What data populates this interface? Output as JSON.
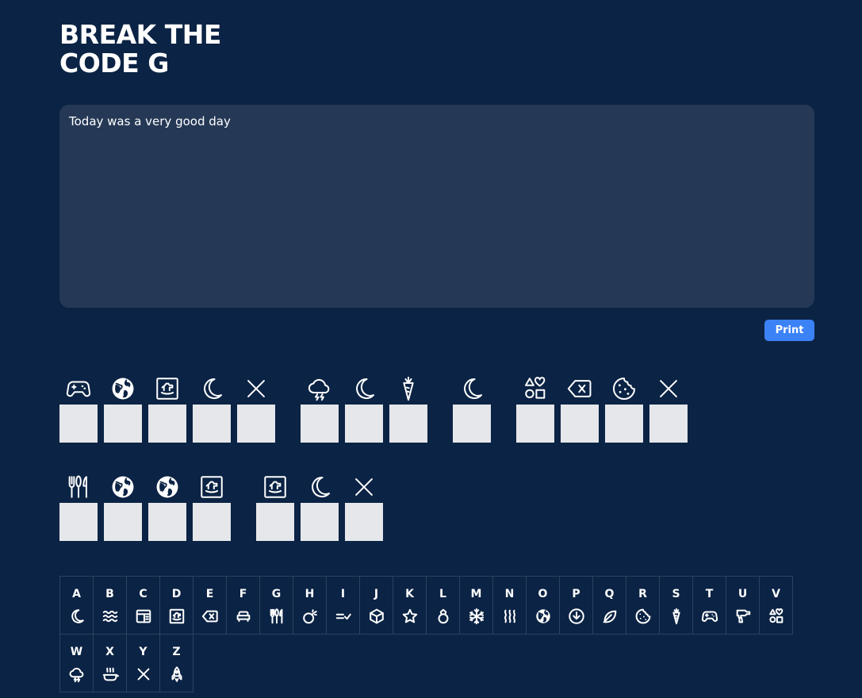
{
  "title": "BREAK THE CODE G",
  "title_lines": [
    "BREAK THE",
    "CODE G"
  ],
  "message": "Today was a very good day",
  "print_label": "Print",
  "colors": {
    "background": "#0b2344",
    "textarea": "#253956",
    "accent": "#3b82f6",
    "box": "#e5e7eb"
  },
  "puzzle": [
    [
      [
        "gamepad-icon",
        "globe-icon",
        "rocking-horse-icon",
        "moon-icon",
        "x-icon"
      ],
      [
        "storm-cloud-icon",
        "moon-icon",
        "carrot-icon"
      ],
      [
        "moon-icon"
      ],
      [
        "shapes-icon",
        "backspace-icon",
        "cookie-icon",
        "x-icon"
      ]
    ],
    [
      [
        "cutlery-icon",
        "globe-icon",
        "globe-icon",
        "rocking-horse-icon"
      ],
      [
        "rocking-horse-icon",
        "moon-icon",
        "x-icon"
      ]
    ]
  ],
  "key": [
    {
      "letter": "A",
      "icon": "moon-icon"
    },
    {
      "letter": "B",
      "icon": "waves-icon"
    },
    {
      "letter": "C",
      "icon": "layout-icon"
    },
    {
      "letter": "D",
      "icon": "rocking-horse-icon"
    },
    {
      "letter": "E",
      "icon": "backspace-icon"
    },
    {
      "letter": "F",
      "icon": "sofa-icon"
    },
    {
      "letter": "G",
      "icon": "cutlery-icon"
    },
    {
      "letter": "H",
      "icon": "bomb-icon"
    },
    {
      "letter": "I",
      "icon": "equal-check-icon"
    },
    {
      "letter": "J",
      "icon": "cube-icon"
    },
    {
      "letter": "K",
      "icon": "star-icon"
    },
    {
      "letter": "L",
      "icon": "ring-icon"
    },
    {
      "letter": "M",
      "icon": "snowflake-icon"
    },
    {
      "letter": "N",
      "icon": "heat-waves-icon"
    },
    {
      "letter": "O",
      "icon": "globe-icon"
    },
    {
      "letter": "P",
      "icon": "download-circle-icon"
    },
    {
      "letter": "Q",
      "icon": "leaf-icon"
    },
    {
      "letter": "R",
      "icon": "cookie-icon"
    },
    {
      "letter": "S",
      "icon": "carrot-icon"
    },
    {
      "letter": "T",
      "icon": "gamepad-icon"
    },
    {
      "letter": "U",
      "icon": "drill-icon"
    },
    {
      "letter": "V",
      "icon": "shapes-icon"
    },
    {
      "letter": "W",
      "icon": "storm-cloud-icon"
    },
    {
      "letter": "X",
      "icon": "cooking-pot-icon"
    },
    {
      "letter": "Y",
      "icon": "x-icon"
    },
    {
      "letter": "Z",
      "icon": "rocket-icon"
    }
  ]
}
